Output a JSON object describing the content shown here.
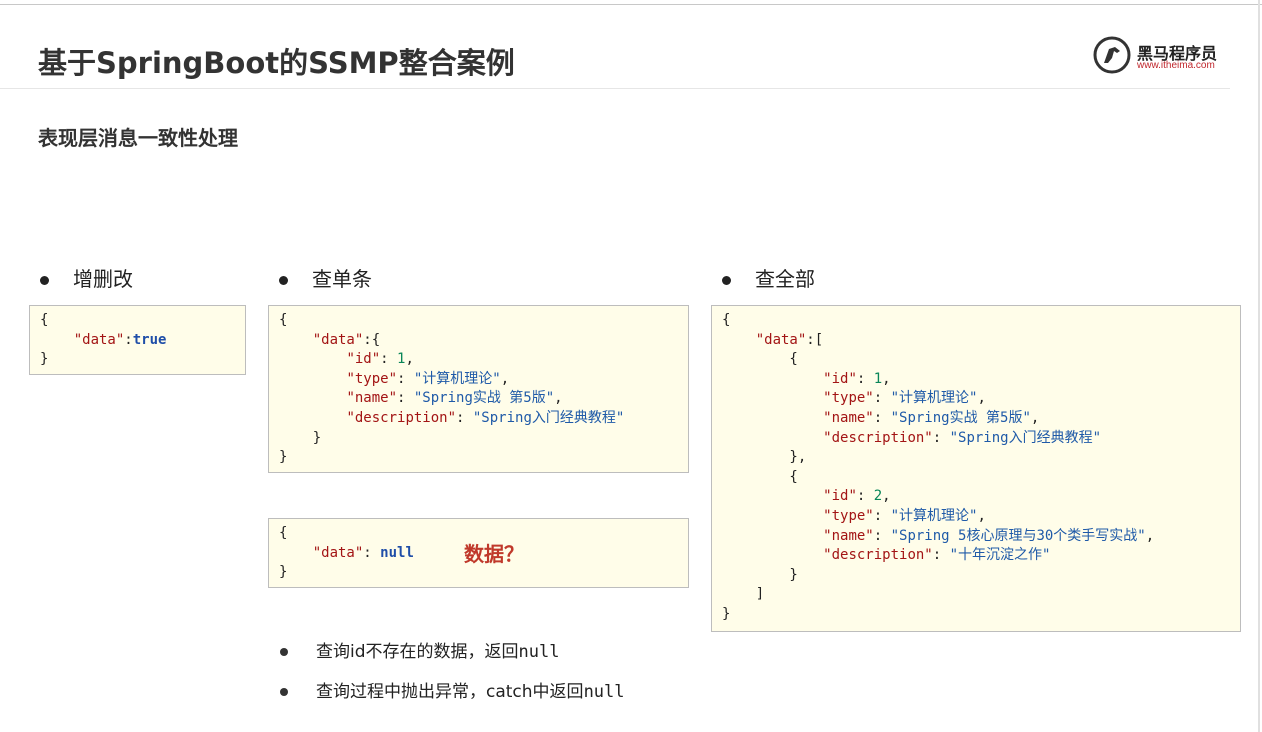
{
  "header": {
    "title": "基于SpringBoot的SSMP整合案例",
    "subtitle": "表现层消息一致性处理",
    "logo_cn": "黑马程序员",
    "logo_url": "www.itheima.com"
  },
  "columns": [
    {
      "label": "增删改"
    },
    {
      "label": "查单条"
    },
    {
      "label": "查全部"
    }
  ],
  "boxes": {
    "crud": {
      "key": "\"data\"",
      "value": "true"
    },
    "single": {
      "data_key": "\"data\"",
      "fields": [
        {
          "k": "\"id\"",
          "v": "1",
          "type": "num"
        },
        {
          "k": "\"type\"",
          "v": "\"计算机理论\"",
          "type": "str"
        },
        {
          "k": "\"name\"",
          "v": "\"Spring实战 第5版\"",
          "type": "str"
        },
        {
          "k": "\"description\"",
          "v": "\"Spring入门经典教程\"",
          "type": "str"
        }
      ]
    },
    "nullbox": {
      "key": "\"data\"",
      "value": "null",
      "callout": "数据？"
    },
    "all": {
      "data_key": "\"data\"",
      "items": [
        [
          {
            "k": "\"id\"",
            "v": "1",
            "type": "num"
          },
          {
            "k": "\"type\"",
            "v": "\"计算机理论\"",
            "type": "str"
          },
          {
            "k": "\"name\"",
            "v": "\"Spring实战 第5版\"",
            "type": "str"
          },
          {
            "k": "\"description\"",
            "v": "\"Spring入门经典教程\"",
            "type": "str"
          }
        ],
        [
          {
            "k": "\"id\"",
            "v": "2",
            "type": "num"
          },
          {
            "k": "\"type\"",
            "v": "\"计算机理论\"",
            "type": "str"
          },
          {
            "k": "\"name\"",
            "v": "\"Spring 5核心原理与30个类手写实战\"",
            "type": "str"
          },
          {
            "k": "\"description\"",
            "v": "\"十年沉淀之作\"",
            "type": "str"
          }
        ]
      ]
    }
  },
  "notes": [
    {
      "pre": "查询id不存在的数据，返回",
      "code": "null"
    },
    {
      "pre": "查询过程中抛出异常，catch中返回",
      "code": "null"
    }
  ]
}
